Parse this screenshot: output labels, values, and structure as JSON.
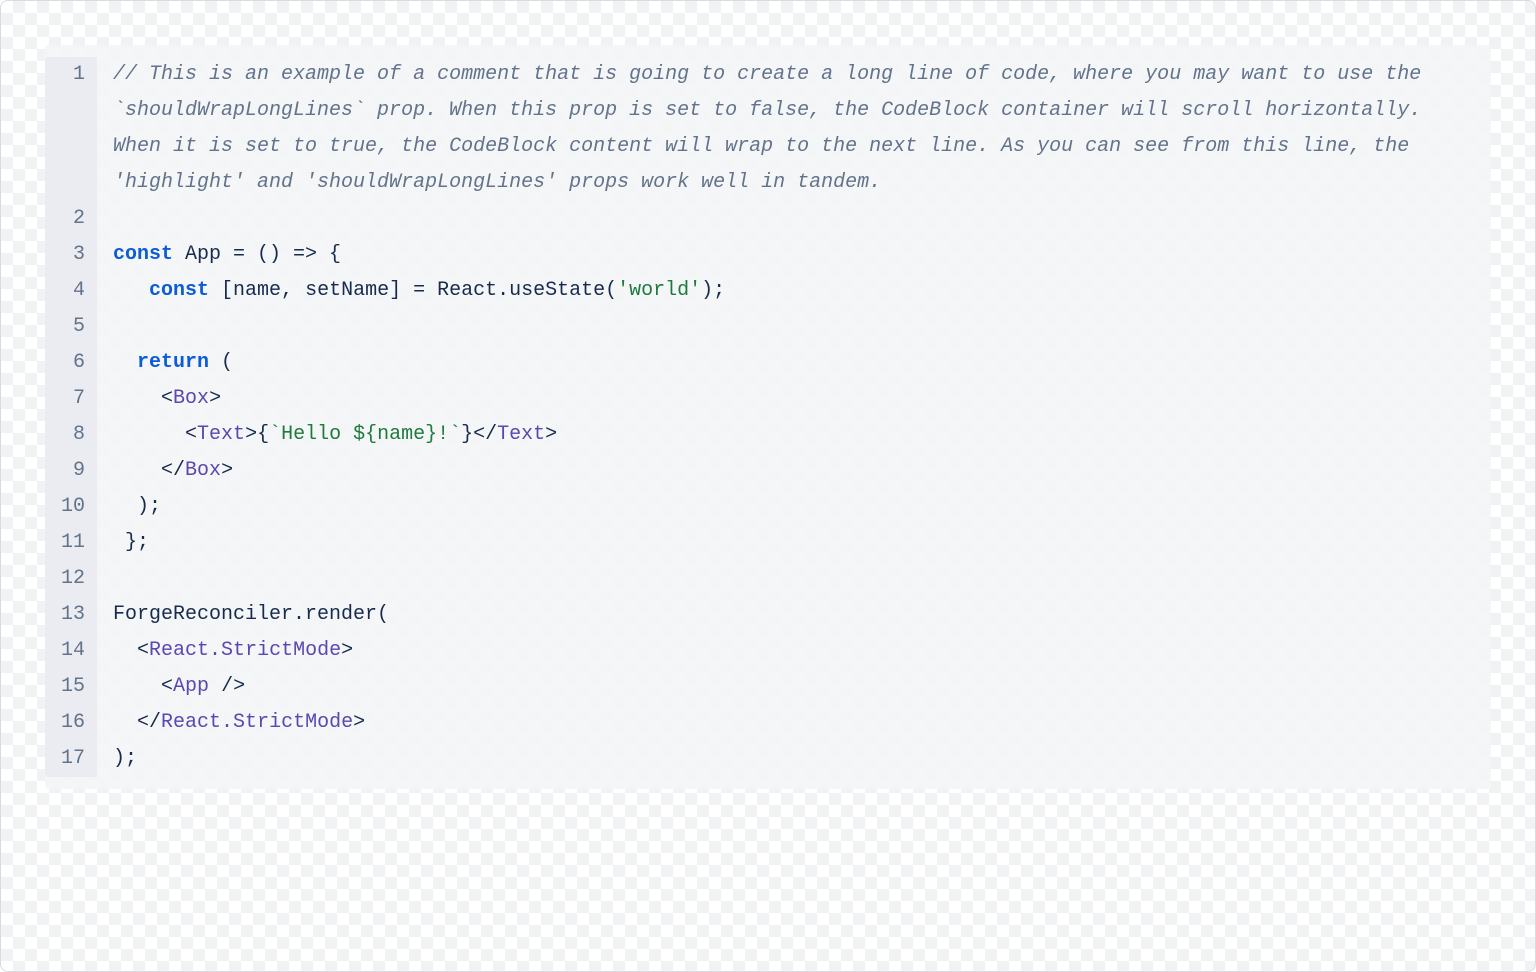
{
  "code": {
    "language": "jsx",
    "lines": [
      {
        "n": 1,
        "tokens": [
          {
            "cls": "t-comment",
            "text": "// This is an example of a comment that is going to create a long line of code, where you may want to use the `shouldWrapLongLines` prop. When this prop is set to false, the CodeBlock container will scroll horizontally. When it is set to true, the CodeBlock content will wrap to the next line. As you can see from this line, the 'highlight' and 'shouldWrapLongLines' props work well in tandem."
          }
        ]
      },
      {
        "n": 2,
        "tokens": [
          {
            "cls": "t-plain",
            "text": ""
          }
        ]
      },
      {
        "n": 3,
        "tokens": [
          {
            "cls": "t-kw",
            "text": "const"
          },
          {
            "cls": "t-plain",
            "text": " App = () => {"
          }
        ]
      },
      {
        "n": 4,
        "tokens": [
          {
            "cls": "t-plain",
            "text": "   "
          },
          {
            "cls": "t-kw",
            "text": "const"
          },
          {
            "cls": "t-plain",
            "text": " [name, setName] = React.useState("
          },
          {
            "cls": "t-str",
            "text": "'world'"
          },
          {
            "cls": "t-plain",
            "text": ");"
          }
        ]
      },
      {
        "n": 5,
        "tokens": [
          {
            "cls": "t-plain",
            "text": ""
          }
        ]
      },
      {
        "n": 6,
        "tokens": [
          {
            "cls": "t-plain",
            "text": "  "
          },
          {
            "cls": "t-kw",
            "text": "return"
          },
          {
            "cls": "t-plain",
            "text": " ("
          }
        ]
      },
      {
        "n": 7,
        "tokens": [
          {
            "cls": "t-plain",
            "text": "    "
          },
          {
            "cls": "t-tagp",
            "text": "<"
          },
          {
            "cls": "t-tag",
            "text": "Box"
          },
          {
            "cls": "t-tagp",
            "text": ">"
          }
        ]
      },
      {
        "n": 8,
        "tokens": [
          {
            "cls": "t-plain",
            "text": "      "
          },
          {
            "cls": "t-tagp",
            "text": "<"
          },
          {
            "cls": "t-tag",
            "text": "Text"
          },
          {
            "cls": "t-tagp",
            "text": ">"
          },
          {
            "cls": "t-punc",
            "text": "{"
          },
          {
            "cls": "t-str",
            "text": "`Hello ${name}!`"
          },
          {
            "cls": "t-punc",
            "text": "}"
          },
          {
            "cls": "t-tagp",
            "text": "</"
          },
          {
            "cls": "t-tag",
            "text": "Text"
          },
          {
            "cls": "t-tagp",
            "text": ">"
          }
        ]
      },
      {
        "n": 9,
        "tokens": [
          {
            "cls": "t-plain",
            "text": "    "
          },
          {
            "cls": "t-tagp",
            "text": "</"
          },
          {
            "cls": "t-tag",
            "text": "Box"
          },
          {
            "cls": "t-tagp",
            "text": ">"
          }
        ]
      },
      {
        "n": 10,
        "tokens": [
          {
            "cls": "t-plain",
            "text": "  );"
          }
        ]
      },
      {
        "n": 11,
        "tokens": [
          {
            "cls": "t-plain",
            "text": " };"
          }
        ]
      },
      {
        "n": 12,
        "tokens": [
          {
            "cls": "t-plain",
            "text": ""
          }
        ]
      },
      {
        "n": 13,
        "tokens": [
          {
            "cls": "t-plain",
            "text": "ForgeReconciler.render("
          }
        ]
      },
      {
        "n": 14,
        "tokens": [
          {
            "cls": "t-plain",
            "text": "  "
          },
          {
            "cls": "t-tagp",
            "text": "<"
          },
          {
            "cls": "t-tag",
            "text": "React.StrictMode"
          },
          {
            "cls": "t-tagp",
            "text": ">"
          }
        ]
      },
      {
        "n": 15,
        "tokens": [
          {
            "cls": "t-plain",
            "text": "    "
          },
          {
            "cls": "t-tagp",
            "text": "<"
          },
          {
            "cls": "t-tag",
            "text": "App"
          },
          {
            "cls": "t-tagp",
            "text": " />"
          }
        ]
      },
      {
        "n": 16,
        "tokens": [
          {
            "cls": "t-plain",
            "text": "  "
          },
          {
            "cls": "t-tagp",
            "text": "</"
          },
          {
            "cls": "t-tag",
            "text": "React.StrictMode"
          },
          {
            "cls": "t-tagp",
            "text": ">"
          }
        ]
      },
      {
        "n": 17,
        "tokens": [
          {
            "cls": "t-plain",
            "text": ");"
          }
        ]
      }
    ]
  }
}
